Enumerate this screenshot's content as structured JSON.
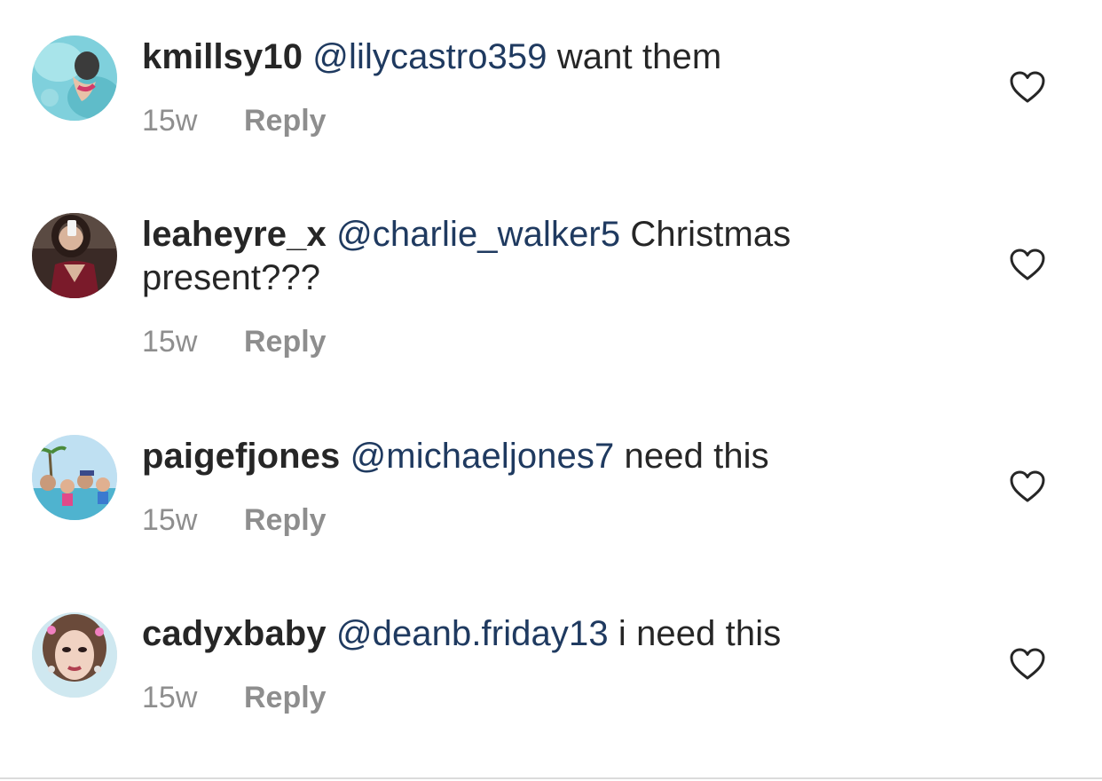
{
  "comments": [
    {
      "username": "kmillsy10",
      "mention": "@lilycastro359",
      "text": " want them",
      "time": "15w",
      "reply_label": "Reply",
      "avatar_icon": "avatar-photo-pool",
      "like_icon": "heart-outline-icon"
    },
    {
      "username": "leaheyre_x",
      "mention": "@charlie_walker5",
      "text": " Christmas present???",
      "time": "15w",
      "reply_label": "Reply",
      "avatar_icon": "avatar-photo-selfie",
      "like_icon": "heart-outline-icon"
    },
    {
      "username": "paigefjones",
      "mention": "@michaeljones7",
      "text": " need this",
      "time": "15w",
      "reply_label": "Reply",
      "avatar_icon": "avatar-photo-family",
      "like_icon": "heart-outline-icon"
    },
    {
      "username": "cadyxbaby",
      "mention": "@deanb.friday13",
      "text": " i need this",
      "time": "15w",
      "reply_label": "Reply",
      "avatar_icon": "avatar-photo-portrait",
      "like_icon": "heart-outline-icon"
    }
  ],
  "colors": {
    "text": "#262626",
    "mention": "#1f3a60",
    "muted": "#8e8e8e",
    "divider": "#dbdbdb"
  }
}
